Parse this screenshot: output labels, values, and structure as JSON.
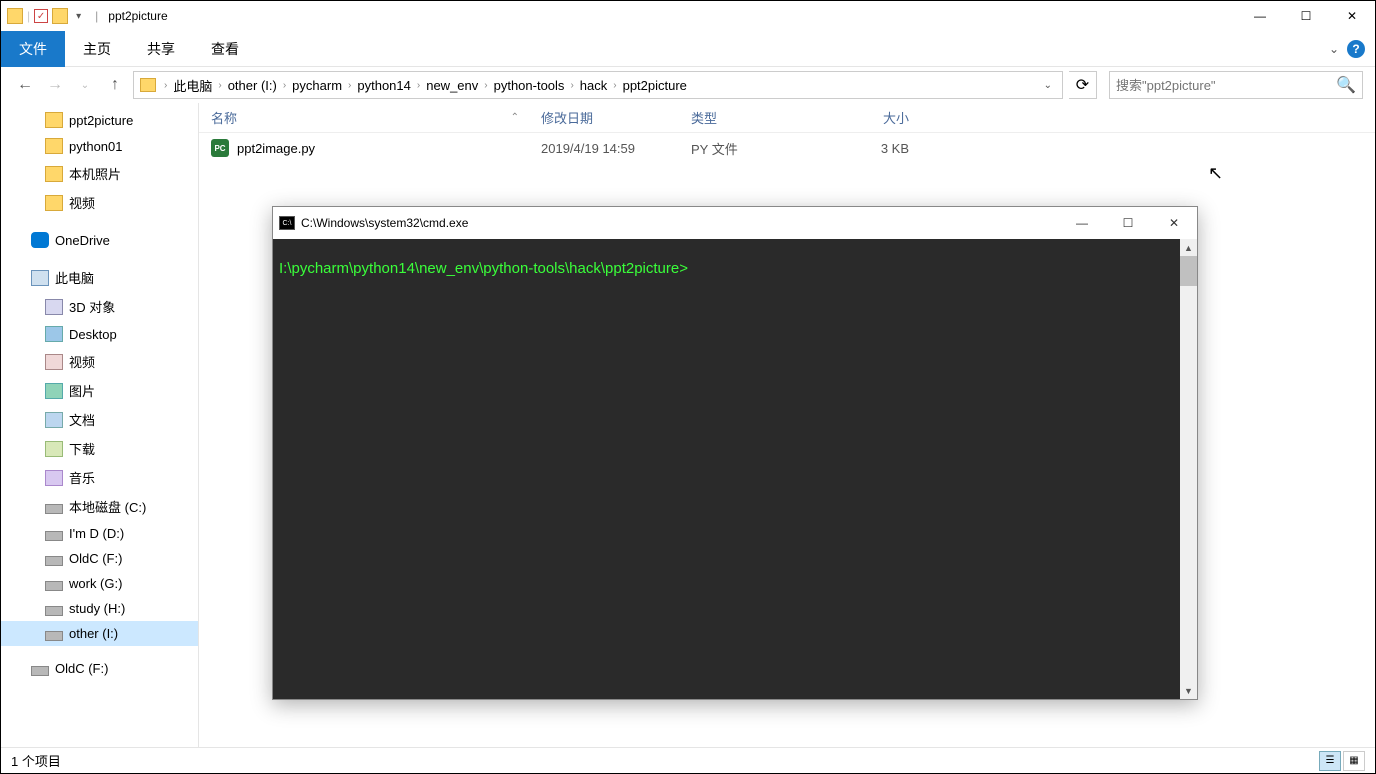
{
  "window": {
    "title": "ppt2picture"
  },
  "ribbon": {
    "file": "文件",
    "tabs": [
      "主页",
      "共享",
      "查看"
    ]
  },
  "nav": {
    "breadcrumb": [
      "此电脑",
      "other (I:)",
      "pycharm",
      "python14",
      "new_env",
      "python-tools",
      "hack",
      "ppt2picture"
    ],
    "search_placeholder": "搜索\"ppt2picture\""
  },
  "sidebar": {
    "items": [
      {
        "label": "ppt2picture",
        "ico": "folder",
        "indent": 1
      },
      {
        "label": "python01",
        "ico": "folder",
        "indent": 1
      },
      {
        "label": "本机照片",
        "ico": "folder",
        "indent": 1
      },
      {
        "label": "视频",
        "ico": "folder",
        "indent": 1
      },
      {
        "label": "OneDrive",
        "ico": "onedrive",
        "indent": 0
      },
      {
        "label": "此电脑",
        "ico": "pc",
        "indent": 0
      },
      {
        "label": "3D 对象",
        "ico": "obj3d",
        "indent": 1
      },
      {
        "label": "Desktop",
        "ico": "desktop",
        "indent": 1
      },
      {
        "label": "视频",
        "ico": "video",
        "indent": 1
      },
      {
        "label": "图片",
        "ico": "pic",
        "indent": 1
      },
      {
        "label": "文档",
        "ico": "doc",
        "indent": 1
      },
      {
        "label": "下载",
        "ico": "down",
        "indent": 1
      },
      {
        "label": "音乐",
        "ico": "music",
        "indent": 1
      },
      {
        "label": "本地磁盘 (C:)",
        "ico": "drive",
        "indent": 1
      },
      {
        "label": "I'm D (D:)",
        "ico": "drive",
        "indent": 1
      },
      {
        "label": "OldC (F:)",
        "ico": "drive",
        "indent": 1
      },
      {
        "label": "work (G:)",
        "ico": "drive",
        "indent": 1
      },
      {
        "label": "study (H:)",
        "ico": "drive",
        "indent": 1
      },
      {
        "label": "other (I:)",
        "ico": "drive",
        "indent": 1,
        "selected": true
      },
      {
        "label": "OldC (F:)",
        "ico": "drive",
        "indent": 0
      }
    ]
  },
  "columns": {
    "name": "名称",
    "date": "修改日期",
    "type": "类型",
    "size": "大小"
  },
  "files": [
    {
      "name": "ppt2image.py",
      "date": "2019/4/19 14:59",
      "type": "PY 文件",
      "size": "3 KB"
    }
  ],
  "cmd": {
    "title": "C:\\Windows\\system32\\cmd.exe",
    "prompt": "I:\\pycharm\\python14\\new_env\\python-tools\\hack\\ppt2picture>"
  },
  "status": {
    "count": "1 个项目"
  }
}
